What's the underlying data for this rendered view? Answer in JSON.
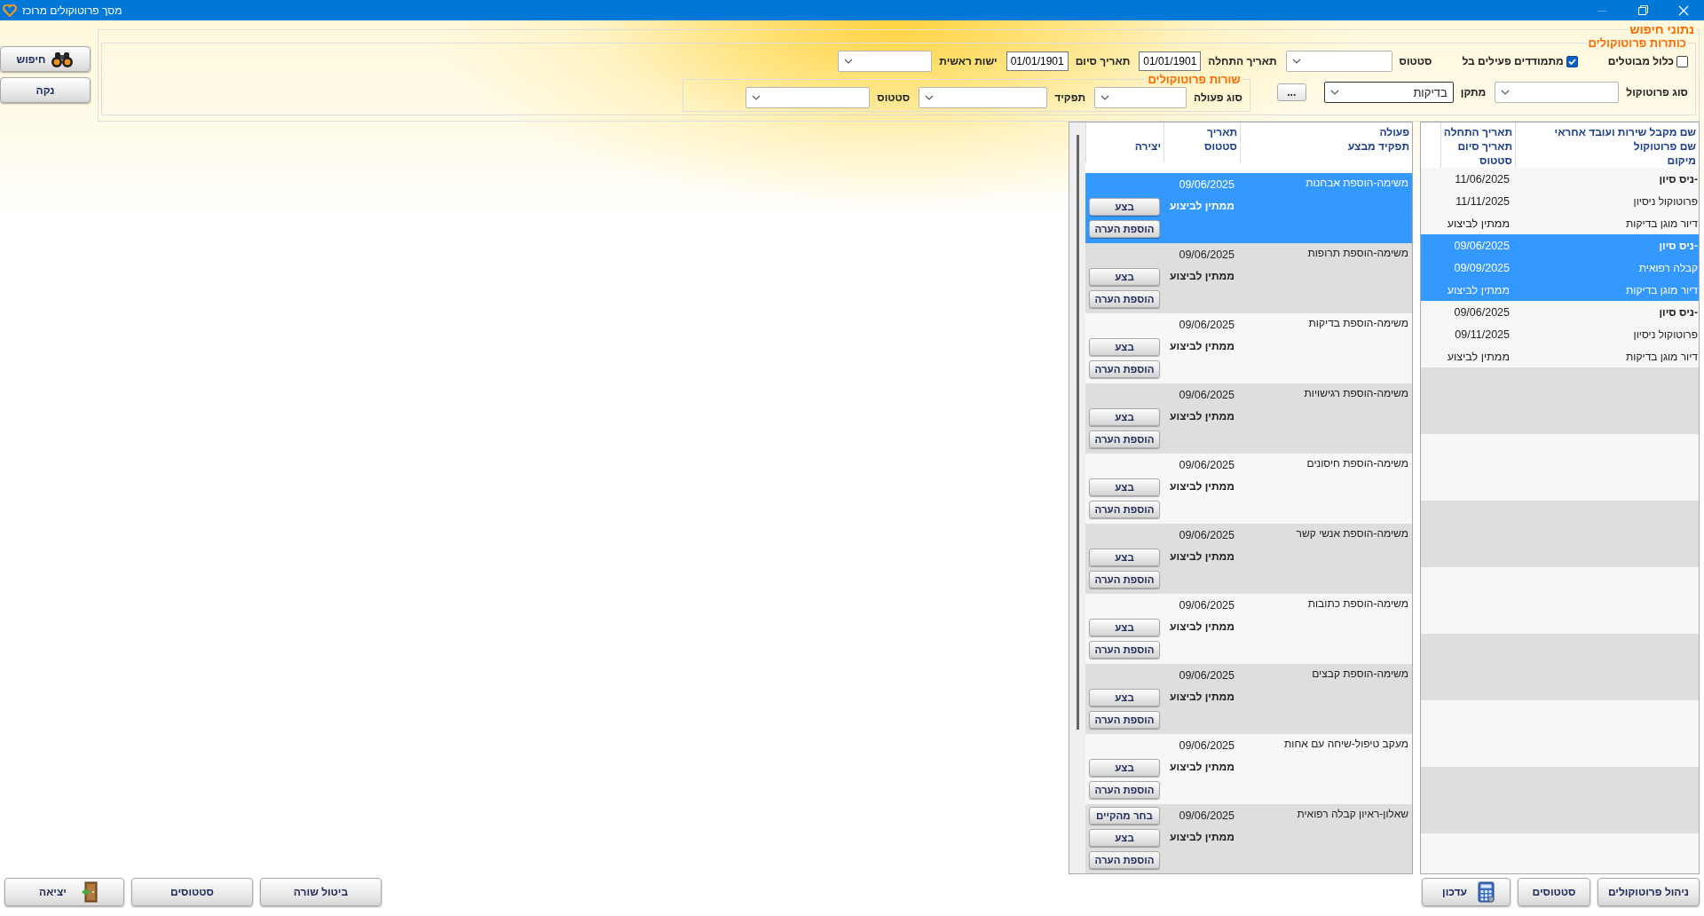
{
  "window": {
    "title": "מסך פרוטוקולים מרוכז"
  },
  "side_buttons": [
    "חיפוש",
    "נקה"
  ],
  "search": {
    "title": "נתוני חיפוש",
    "headers": {
      "title": "כותרות פרוטוקולים",
      "row_1": [
        {
          "kind": "checkbox",
          "label": "כלול מבוטלים",
          "checked": false
        },
        {
          "kind": "checkbox",
          "label": "מתמודדים פעילים בל",
          "checked": true
        },
        {
          "kind": "combo",
          "label": "סטטוס"
        },
        {
          "kind": "date",
          "label": "תאריך התחלה",
          "value": "01/01/1901"
        },
        {
          "kind": "date",
          "label": "תאריך סיום",
          "value": "01/01/1901"
        },
        {
          "kind": "combo",
          "label": "ישות ראשית"
        }
      ],
      "row_2": [
        {
          "kind": "combo",
          "label": "סוג פרוטוקול"
        },
        {
          "kind": "combo",
          "label": "מתקן",
          "value": "בדיקות"
        },
        {
          "kind": "button",
          "label": "..."
        }
      ]
    },
    "lines": {
      "title": "שורות פרוטוקולים",
      "fields": [
        {
          "kind": "combo",
          "label": "סוג פעולה"
        },
        {
          "kind": "combo",
          "label": "תפקיד"
        },
        {
          "kind": "combo",
          "label": "סטטוס"
        }
      ]
    }
  },
  "protocols": {
    "columns": [
      {
        "lines": [
          "שם מקבל שירות ועובד אחראי",
          "שם פרוטוקול",
          "מיקום"
        ]
      },
      {
        "lines": [
          "תאריך התחלה",
          "תאריך סיום",
          "סטטוס"
        ]
      }
    ],
    "rows": [
      {
        "name": "-ניס סיון",
        "protocol": "פרוטוקול ניסיון",
        "location": "דיור מוגן בדיקות",
        "start": "11/06/2025",
        "end": "11/11/2025",
        "status": "ממתין לביצוע",
        "selected": false
      },
      {
        "name": "-ניס סיון",
        "protocol": "קבלה רפואית",
        "location": "דיור מוגן בדיקות",
        "start": "09/06/2025",
        "end": "09/09/2025",
        "status": "ממתין לביצוע",
        "selected": true
      },
      {
        "name": "-ניס סיון",
        "protocol": "פרוטוקול ניסיון",
        "location": "דיור מוגן בדיקות",
        "start": "09/06/2025",
        "end": "09/11/2025",
        "status": "ממתין לביצוע",
        "selected": false
      }
    ]
  },
  "lines": {
    "columns": [
      {
        "lines": [
          "פעולה",
          "תפקיד מבצע"
        ]
      },
      {
        "lines": [
          "תאריך",
          "סטטוס"
        ]
      },
      {
        "lines": [
          "יצירה"
        ]
      }
    ],
    "rows": [
      {
        "action": "משימה-הוספת אבחנות",
        "date": "09/06/2025",
        "status": "ממתין לביצוע",
        "buttons": [
          "בצע",
          "הוספת הערה"
        ],
        "selected": true
      },
      {
        "action": "משימה-הוספת תרופות",
        "date": "09/06/2025",
        "status": "ממתין לביצוע",
        "buttons": [
          "בצע",
          "הוספת הערה"
        ],
        "selected": false
      },
      {
        "action": "משימה-הוספת בדיקות",
        "date": "09/06/2025",
        "status": "ממתין לביצוע",
        "buttons": [
          "בצע",
          "הוספת הערה"
        ],
        "selected": false
      },
      {
        "action": "משימה-הוספת רגישויות",
        "date": "09/06/2025",
        "status": "ממתין לביצוע",
        "buttons": [
          "בצע",
          "הוספת הערה"
        ],
        "selected": false
      },
      {
        "action": "משימה-הוספת חיסונים",
        "date": "09/06/2025",
        "status": "ממתין לביצוע",
        "buttons": [
          "בצע",
          "הוספת הערה"
        ],
        "selected": false
      },
      {
        "action": "משימה-הוספת אנשי קשר",
        "date": "09/06/2025",
        "status": "ממתין לביצוע",
        "buttons": [
          "בצע",
          "הוספת הערה"
        ],
        "selected": false
      },
      {
        "action": "משימה-הוספת כתובות",
        "date": "09/06/2025",
        "status": "ממתין לביצוע",
        "buttons": [
          "בצע",
          "הוספת הערה"
        ],
        "selected": false
      },
      {
        "action": "משימה-הוספת קבצים",
        "date": "09/06/2025",
        "status": "ממתין לביצוע",
        "buttons": [
          "בצע",
          "הוספת הערה"
        ],
        "selected": false
      },
      {
        "action": "מעקב טיפול-שיחה עם אחות",
        "date": "09/06/2025",
        "status": "ממתין לביצוע",
        "buttons": [
          "בצע",
          "הוספת הערה"
        ],
        "selected": false
      },
      {
        "action": "שאלון-ראיון קבלה רפואית",
        "date": "09/06/2025",
        "status": "ממתין לביצוע",
        "buttons": [
          "בחר מהקיים",
          "בצע",
          "הוספת הערה"
        ],
        "selected": false
      }
    ]
  },
  "bottom_right": [
    "ניהול פרוטוקולים",
    "סטטוסים",
    "עדכון"
  ],
  "bottom_left": [
    "ביטול שורה",
    "סטטוסים",
    "יציאה"
  ]
}
